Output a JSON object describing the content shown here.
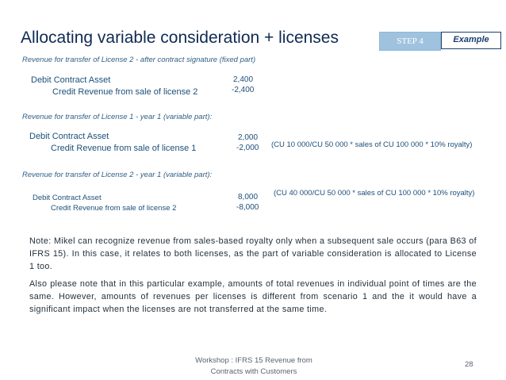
{
  "title": "Allocating variable consideration + licenses",
  "badges": {
    "step": "STEP 4",
    "example": "Example"
  },
  "sections": [
    {
      "label": "Revenue for transfer of License 2 - after contract signature (fixed part)",
      "debit": "Debit Contract Asset",
      "credit": "Credit Revenue from sale of license 2",
      "debit_amount": "2,400",
      "credit_amount": "-2,400",
      "calc": ""
    },
    {
      "label": "Revenue for transfer of License 1 - year 1 (variable part):",
      "debit": "Debit Contract Asset",
      "credit": "Credit Revenue from sale of license 1",
      "debit_amount": "2,000",
      "credit_amount": "-2,000",
      "calc": "(CU 10 000/CU 50 000 * sales of CU 100 000 * 10% royalty)"
    },
    {
      "label": "Revenue for transfer of License 2 - year 1 (variable part):",
      "debit": "Debit Contract Asset",
      "credit": "Credit Revenue from sale of license 2",
      "debit_amount": "8,000",
      "credit_amount": "-8,000",
      "calc": "(CU 40 000/CU 50 000 * sales of CU 100 000 * 10% royalty)"
    }
  ],
  "notes": [
    "Note: Mikel can recognize revenue from sales-based royalty only when a subsequent sale occurs (para B63 of IFRS 15). In this case, it relates to both licenses, as the part of variable consideration is allocated to License 1 too.",
    "Also please note that in this particular example, amounts of total revenues in individual point of times are the same. However, amounts of revenues per licenses is different from scenario 1 and the it would have a significant impact when the licenses are not transferred at the same time."
  ],
  "footer": {
    "line1": "Workshop : IFRS 15 Revenue from",
    "line2": "Contracts with Customers",
    "page_number": "28"
  }
}
